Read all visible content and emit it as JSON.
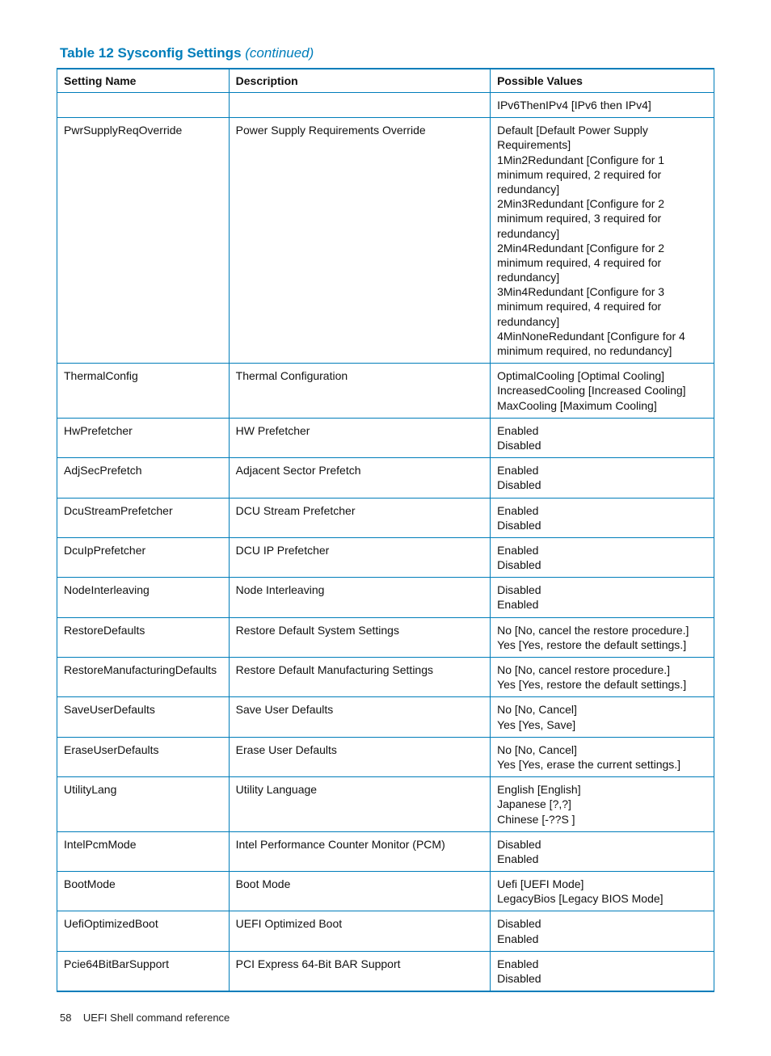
{
  "title": {
    "prefix": "Table 12 Sysconfig Settings ",
    "suffix": "(continued)"
  },
  "columns": [
    "Setting Name",
    "Description",
    "Possible Values"
  ],
  "rows": [
    {
      "name": "",
      "desc": "",
      "values": "IPv6ThenIPv4 [IPv6 then IPv4]"
    },
    {
      "name": "PwrSupplyReqOverride",
      "desc": "Power Supply Requirements Override",
      "values": "Default [Default Power Supply Requirements]\n1Min2Redundant [Configure for 1 minimum required, 2 required for redundancy]\n2Min3Redundant [Configure for 2 minimum required, 3 required for redundancy]\n2Min4Redundant [Configure for 2 minimum required, 4 required for redundancy]\n3Min4Redundant [Configure for 3 minimum required, 4 required for redundancy]\n4MinNoneRedundant [Configure for 4 minimum required, no redundancy]"
    },
    {
      "name": "ThermalConfig",
      "desc": "Thermal Configuration",
      "values": "OptimalCooling [Optimal Cooling]\nIncreasedCooling [Increased Cooling]\nMaxCooling [Maximum Cooling]"
    },
    {
      "name": "HwPrefetcher",
      "desc": "HW Prefetcher",
      "values": "Enabled\nDisabled"
    },
    {
      "name": "AdjSecPrefetch",
      "desc": "Adjacent Sector Prefetch",
      "values": "Enabled\nDisabled"
    },
    {
      "name": "DcuStreamPrefetcher",
      "desc": "DCU Stream Prefetcher",
      "values": "Enabled\nDisabled"
    },
    {
      "name": "DcuIpPrefetcher",
      "desc": "DCU IP Prefetcher",
      "values": "Enabled\nDisabled"
    },
    {
      "name": "NodeInterleaving",
      "desc": "Node Interleaving",
      "values": "Disabled\nEnabled"
    },
    {
      "name": "RestoreDefaults",
      "desc": "Restore Default System Settings",
      "values": "No [No, cancel the restore procedure.]\nYes [Yes, restore the default settings.]"
    },
    {
      "name": "RestoreManufacturingDefaults",
      "desc": "Restore Default Manufacturing Settings",
      "values": "No [No, cancel restore procedure.]\nYes [Yes, restore the default settings.]"
    },
    {
      "name": "SaveUserDefaults",
      "desc": "Save User Defaults",
      "values": "No [No, Cancel]\nYes [Yes, Save]"
    },
    {
      "name": "EraseUserDefaults",
      "desc": "Erase User Defaults",
      "values": "No [No, Cancel]\nYes [Yes, erase the current settings.]"
    },
    {
      "name": "UtilityLang",
      "desc": "Utility Language",
      "values": "English [English]\nJapanese [?,?]\nChinese [-??S ]"
    },
    {
      "name": "IntelPcmMode",
      "desc": "Intel Performance Counter Monitor (PCM)",
      "values": "Disabled\nEnabled"
    },
    {
      "name": "BootMode",
      "desc": "Boot Mode",
      "values": "Uefi [UEFI Mode]\nLegacyBios [Legacy BIOS Mode]"
    },
    {
      "name": "UefiOptimizedBoot",
      "desc": "UEFI Optimized Boot",
      "values": "Disabled\nEnabled"
    },
    {
      "name": "Pcie64BitBarSupport",
      "desc": "PCI Express 64-Bit BAR Support",
      "values": "Enabled\nDisabled"
    }
  ],
  "footer": {
    "page": "58",
    "title": "UEFI Shell command reference"
  }
}
